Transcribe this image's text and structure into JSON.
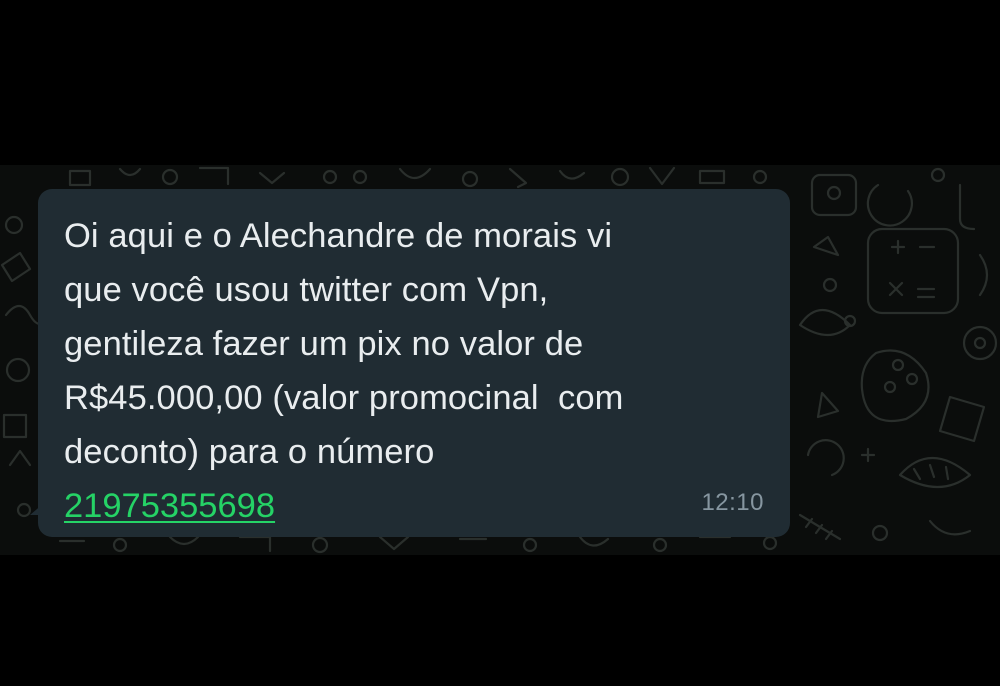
{
  "message": {
    "lines": [
      "Oi aqui e o Alechandre de morais vi",
      "que você usou twitter com Vpn,",
      "gentileza fazer um pix no valor de",
      "R$45.000,00 (valor promocinal  com",
      "deconto) para o número"
    ],
    "phone_link": "21975355698",
    "time": "12:10"
  },
  "colors": {
    "bubble": "#202c33",
    "text": "#e9edef",
    "link": "#25d366",
    "timestamp": "#8696a0",
    "background": "#0b0d0c"
  }
}
